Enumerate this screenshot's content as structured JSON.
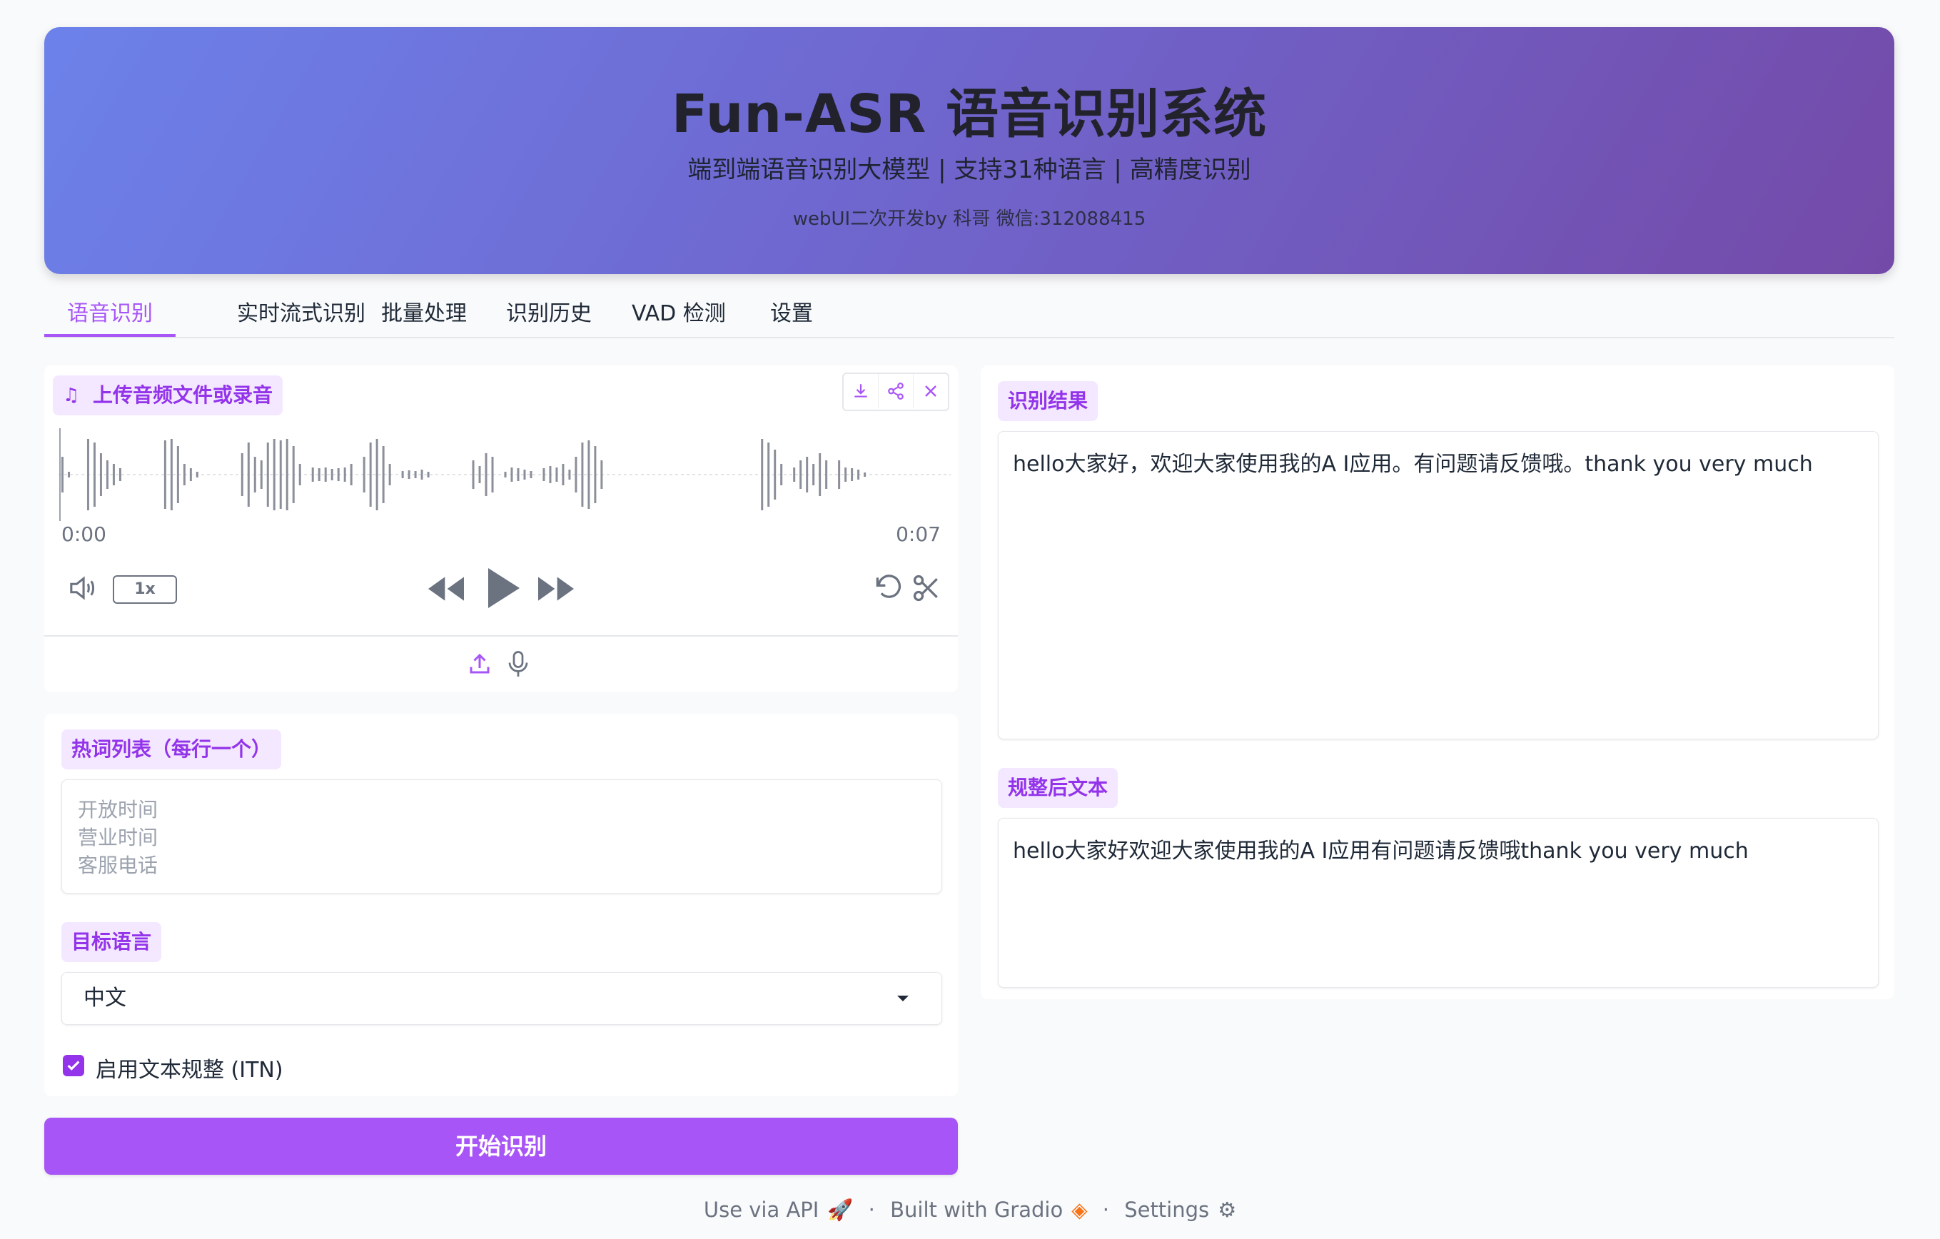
{
  "header": {
    "title": "Fun-ASR 语音识别系统",
    "subtitle": "端到端语音识别大模型 | 支持31种语言 | 高精度识别",
    "credit": "webUI二次开发by 科哥 微信:312088415"
  },
  "tabs": [
    {
      "label": "语音识别",
      "active": true
    },
    {
      "label": "实时流式识别"
    },
    {
      "label": "批量处理"
    },
    {
      "label": "识别历史"
    },
    {
      "label": "VAD 检测"
    },
    {
      "label": "设置"
    }
  ],
  "audio": {
    "label": "上传音频文件或录音",
    "current_time": "0:00",
    "duration": "0:07",
    "playback_rate": "1x"
  },
  "hotwords": {
    "label": "热词列表（每行一个）",
    "lines": [
      "开放时间",
      "营业时间",
      "客服电话"
    ]
  },
  "language": {
    "label": "目标语言",
    "selected": "中文"
  },
  "itn": {
    "label": "启用文本规整 (ITN)",
    "checked": true
  },
  "start_button": "开始识别",
  "result": {
    "label": "识别结果",
    "text": "hello大家好，欢迎大家使用我的A I应用。有问题请反馈哦。thank you very much"
  },
  "normalized": {
    "label": "规整后文本",
    "text": "hello大家好欢迎大家使用我的A I应用有问题请反馈哦thank you very much"
  },
  "footer": {
    "api": "Use via API",
    "gradio": "Built with Gradio",
    "settings": "Settings",
    "separator": "·"
  },
  "colors": {
    "accent": "#a855f7",
    "chip_bg": "#f3e8ff",
    "header_gradient_start": "#6c82ea",
    "header_gradient_end": "#744aa8"
  }
}
